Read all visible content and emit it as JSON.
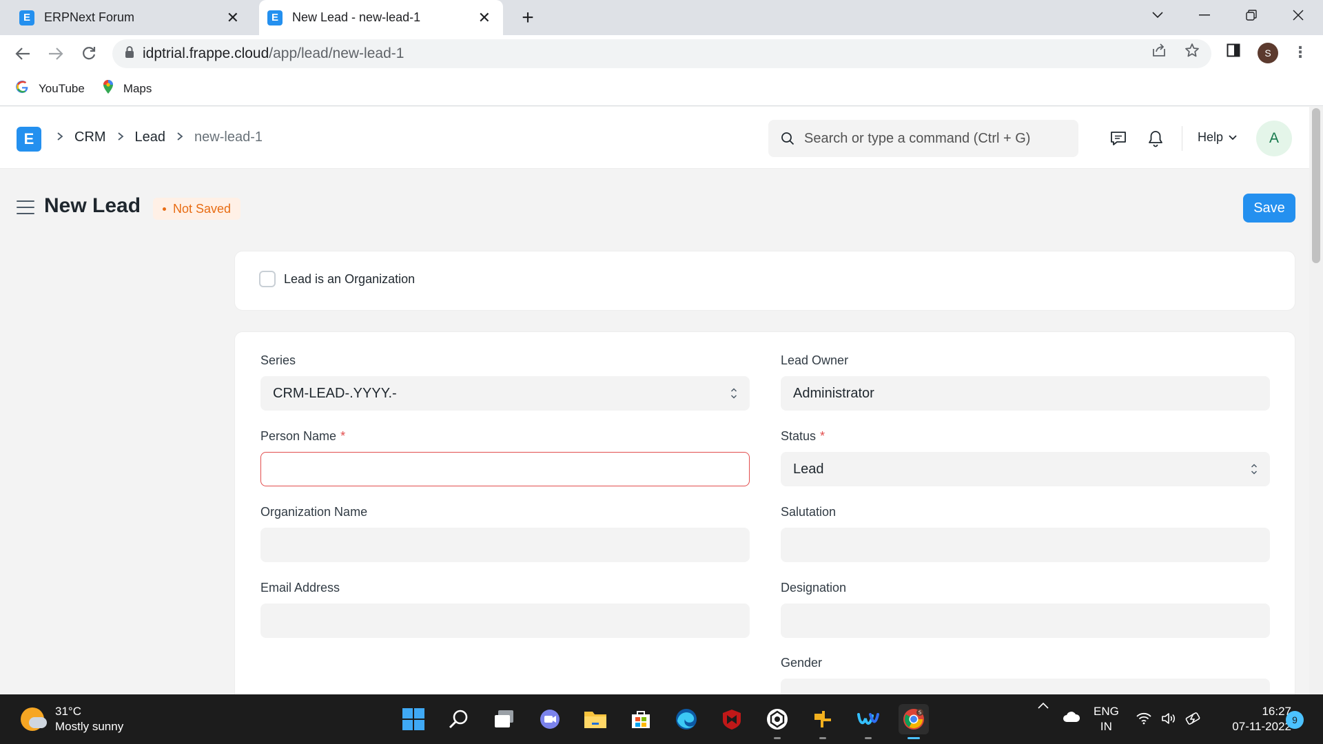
{
  "browser": {
    "tabs": [
      {
        "title": "ERPNext Forum",
        "favicon": "E"
      },
      {
        "title": "New Lead - new-lead-1",
        "favicon": "E"
      }
    ],
    "url_host": "idptrial.frappe.cloud",
    "url_path": "/app/lead/new-lead-1",
    "profile_initial": "S",
    "bookmarks": [
      {
        "label": "YouTube",
        "icon": "google-icon"
      },
      {
        "label": "Maps",
        "icon": "maps-pin-icon"
      }
    ]
  },
  "navbar": {
    "logo_letter": "E",
    "breadcrumbs": [
      "CRM",
      "Lead",
      "new-lead-1"
    ],
    "search_placeholder": "Search or type a command (Ctrl + G)",
    "help_label": "Help",
    "avatar_initial": "A"
  },
  "page": {
    "title": "New Lead",
    "status": "Not Saved",
    "save_label": "Save"
  },
  "form": {
    "org_checkbox_label": "Lead is an Organization",
    "fields": {
      "series": {
        "label": "Series",
        "value": "CRM-LEAD-.YYYY.-"
      },
      "lead_owner": {
        "label": "Lead Owner",
        "value": "Administrator"
      },
      "person_name": {
        "label": "Person Name",
        "value": "",
        "required": "*"
      },
      "status": {
        "label": "Status",
        "value": "Lead",
        "required": "*"
      },
      "organization_name": {
        "label": "Organization Name",
        "value": ""
      },
      "salutation": {
        "label": "Salutation",
        "value": ""
      },
      "email_address": {
        "label": "Email Address",
        "value": ""
      },
      "designation": {
        "label": "Designation",
        "value": ""
      },
      "gender": {
        "label": "Gender",
        "value": ""
      }
    }
  },
  "taskbar": {
    "weather_temp": "31°C",
    "weather_desc": "Mostly sunny",
    "lang_top": "ENG",
    "lang_bottom": "IN",
    "time": "16:27",
    "date": "07-11-2022",
    "notification_count": "9",
    "chrome_badge": "S"
  },
  "colors": {
    "primary": "#2490ef",
    "indicator_orange": "#e86c13",
    "required_red": "#e24c4c"
  }
}
